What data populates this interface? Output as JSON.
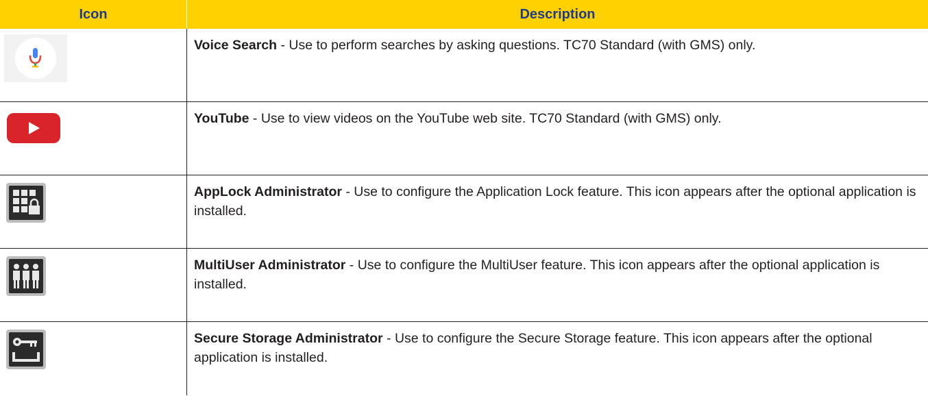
{
  "header": {
    "icon_col": "Icon",
    "desc_col": "Description"
  },
  "rows": [
    {
      "icon": "microphone-icon",
      "name": "Voice Search",
      "text": " - Use to perform searches by asking questions. TC70 Standard (with GMS) only."
    },
    {
      "icon": "youtube-icon",
      "name": "YouTube",
      "text": " - Use to view videos on the YouTube web site. TC70 Standard (with GMS) only."
    },
    {
      "icon": "applock-icon",
      "name": "AppLock Administrator",
      "text": " - Use to configure the Application Lock feature. This icon appears after the optional application is installed."
    },
    {
      "icon": "multiuser-icon",
      "name": "MultiUser Administrator",
      "text": " - Use to configure the MultiUser feature. This icon appears after the optional application is installed."
    },
    {
      "icon": "secure-storage-icon",
      "name": "Secure Storage Administrator",
      "text": " - Use to configure the Secure Storage feature. This icon appears after the optional application is installed."
    }
  ],
  "colors": {
    "header_bg": "#ffd100",
    "header_text": "#1f3c8c"
  }
}
